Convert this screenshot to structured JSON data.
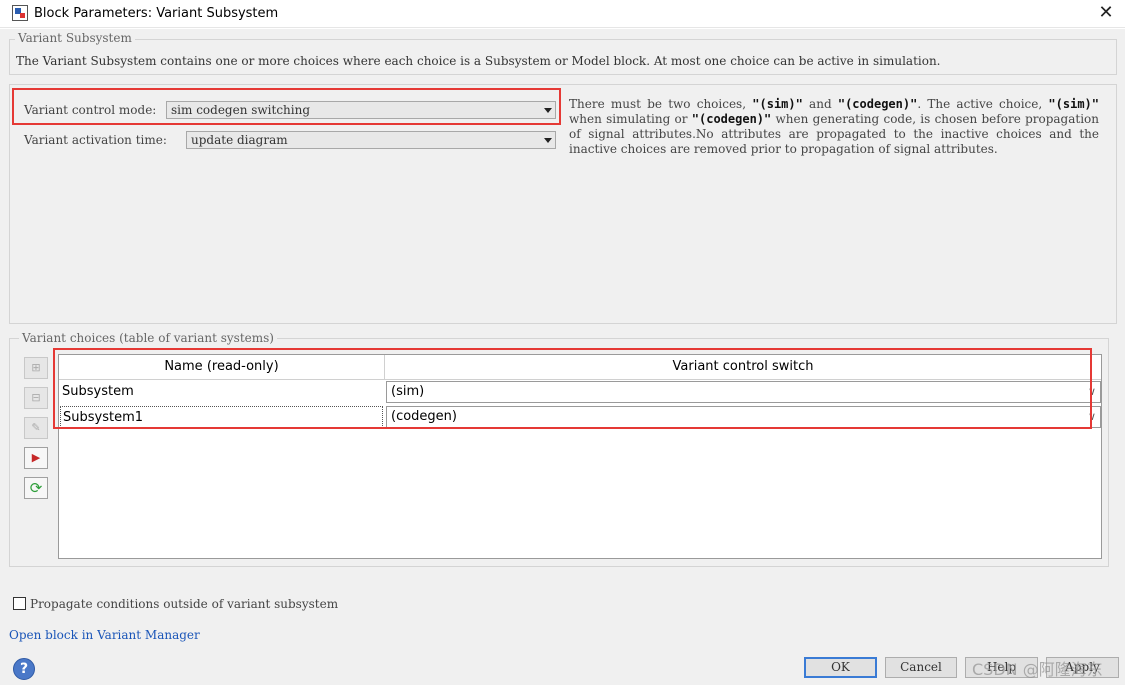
{
  "window": {
    "title": "Block Parameters: Variant Subsystem",
    "close_glyph": "✕"
  },
  "block_group": {
    "legend": "Variant Subsystem",
    "description": "The Variant Subsystem contains one or more choices where each choice is a Subsystem or Model block. At most one choice can be active in simulation."
  },
  "params": {
    "control_mode_label": "Variant control mode:",
    "control_mode_value": "sim codegen switching",
    "activation_time_label": "Variant activation time:",
    "activation_time_value": "update diagram"
  },
  "help": {
    "t1": "There must be two choices, ",
    "sim": "\"(sim)\"",
    "and": " and ",
    "codegen": "\"(codegen)\"",
    "t2": ". The active choice, ",
    "t3": " when simulating or ",
    "t4": " when generating code, is chosen before propagation of signal attributes.No attributes are propagated to the inactive choices and the inactive choices are removed prior to propagation of signal attributes."
  },
  "choices": {
    "legend": "Variant choices (table of variant systems)",
    "columns": [
      "Name (read-only)",
      "Variant control switch"
    ],
    "rows": [
      {
        "name": "Subsystem",
        "switch": "(sim)"
      },
      {
        "name": "Subsystem1",
        "switch": "(codegen)"
      }
    ]
  },
  "options": {
    "propagate_label": "Propagate conditions outside of variant subsystem",
    "propagate_checked": false
  },
  "links": {
    "open_variant_manager": "Open block in Variant Manager"
  },
  "buttons": {
    "ok": "OK",
    "cancel": "Cancel",
    "help": "Help",
    "apply": "Apply"
  },
  "watermark": "CSDN @阿隆海东"
}
